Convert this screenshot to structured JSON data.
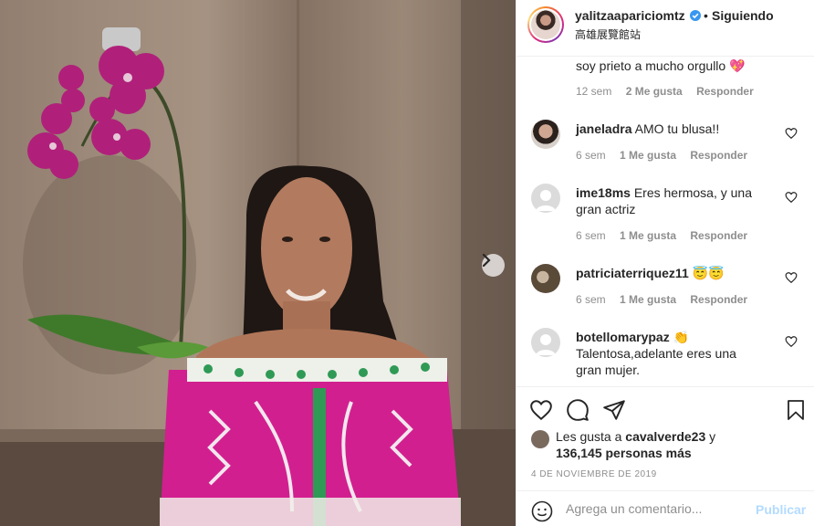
{
  "post": {
    "username": "yalitzaapariciomtz",
    "separator": "•",
    "follow_status": "Siguiendo",
    "location": "高雄展覽館站"
  },
  "comments": [
    {
      "text": "soy prieto a mucho orgullo 💖",
      "age": "12 sem",
      "likes": "2 Me gusta",
      "reply": "Responder"
    },
    {
      "user": "janeladra",
      "text": "AMO tu blusa!!",
      "age": "6 sem",
      "likes": "1 Me gusta",
      "reply": "Responder"
    },
    {
      "user": "ime18ms",
      "text": "Eres hermosa, y una gran actriz",
      "age": "6 sem",
      "likes": "1 Me gusta",
      "reply": "Responder"
    },
    {
      "user": "patriciaterriquez11",
      "text": "😇😇",
      "age": "6 sem",
      "likes": "1 Me gusta",
      "reply": "Responder"
    },
    {
      "user": "botellomarypaz",
      "text": "👏",
      "text2": "Talentosa,adelante eres una gran mujer."
    }
  ],
  "likes": {
    "prefix": "Les gusta a",
    "user": "cavalverde23",
    "conj": "y",
    "count": "136,145 personas más"
  },
  "date": "4 DE NOVIEMBRE DE 2019",
  "composer": {
    "placeholder": "Agrega un comentario...",
    "publish_label": "Publicar"
  },
  "icons": {
    "verified": "verified-badge-icon",
    "like": "heart-icon",
    "comment": "comment-bubble-icon",
    "share": "paper-plane-icon",
    "save": "bookmark-icon",
    "next": "chevron-right-icon",
    "emoji": "smiley-icon"
  },
  "colors": {
    "text": "#262626",
    "muted": "#8e8e8e",
    "border": "#efefef",
    "verified_blue": "#3897f0",
    "publish_disabled": "#b3dbff",
    "blouse_pink": "#d21f8f"
  }
}
